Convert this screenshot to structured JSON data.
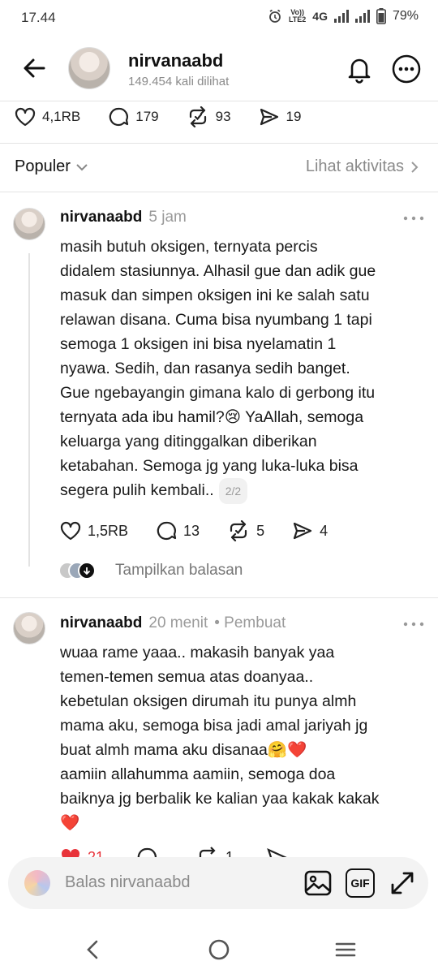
{
  "status_bar": {
    "time": "17.44",
    "volte_line1": "Vo))",
    "volte_line2": "LTE2",
    "network": "4G",
    "battery": "79%"
  },
  "header": {
    "username": "nirvanaabd",
    "views": "149.454 kali dilihat"
  },
  "top_stats": {
    "likes": "4,1RB",
    "comments": "179",
    "reposts": "93",
    "shares": "19"
  },
  "sort": {
    "label": "Populer",
    "activity_label": "Lihat aktivitas"
  },
  "posts": [
    {
      "username": "nirvanaabd",
      "time": "5 jam",
      "text": "masih butuh oksigen, ternyata percis\ndidalem stasiunnya. Alhasil gue dan adik gue\nmasuk dan simpen oksigen ini ke salah satu\nrelawan disana. Cuma bisa nyumbang 1 tapi\nsemoga 1 oksigen ini bisa nyelamatin 1\nnyawa. Sedih, dan rasanya sedih banget.\nGue ngebayangin gimana kalo di gerbong itu\nternyata ada ibu hamil?😢 YaAllah, semoga\nkeluarga yang ditinggalkan diberikan\nketabahan. Semoga jg yang luka-luka bisa\nsegera pulih kembali..",
      "page": "2/2",
      "likes": "1,5RB",
      "comments": "13",
      "reposts": "5",
      "shares": "4",
      "show_replies": "Tampilkan balasan"
    },
    {
      "username": "nirvanaabd",
      "time": "20 menit",
      "badge": "• Pembuat",
      "text": "wuaa rame yaaa.. makasih banyak yaa\ntemen-temen semua atas doanyaa..\nkebetulan oksigen dirumah itu punya almh\nmama aku, semoga bisa jadi amal jariyah jg\nbuat almh mama aku disanaa🤗❤️\naamiin allahumma aamiin, semoga doa\nbaiknya jg berbalik ke kalian yaa kakak kakak\n❤️",
      "likes": "21",
      "comments": "",
      "reposts": "1",
      "shares": ""
    }
  ],
  "reply_bar": {
    "placeholder": "Balas nirvanaabd",
    "gif_label": "GIF"
  },
  "colors": {
    "like_red": "#e8333a",
    "muted": "#8a8a8a",
    "divider": "#e4e4e4"
  }
}
